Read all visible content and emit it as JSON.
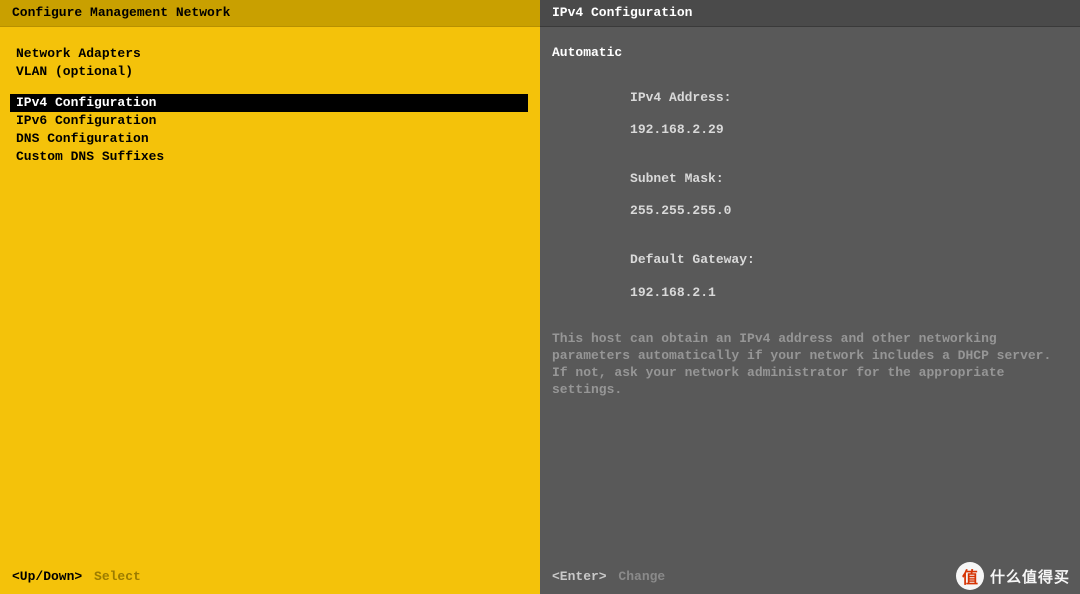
{
  "left": {
    "title": "Configure Management Network",
    "groups": [
      {
        "items": [
          {
            "label": "Network Adapters",
            "selected": false
          },
          {
            "label": "VLAN (optional)",
            "selected": false
          }
        ]
      },
      {
        "items": [
          {
            "label": "IPv4 Configuration",
            "selected": true
          },
          {
            "label": "IPv6 Configuration",
            "selected": false
          },
          {
            "label": "DNS Configuration",
            "selected": false
          },
          {
            "label": "Custom DNS Suffixes",
            "selected": false
          }
        ]
      }
    ],
    "footer_key": "<Up/Down>",
    "footer_action": "Select"
  },
  "right": {
    "title": "IPv4 Configuration",
    "mode": "Automatic",
    "props": [
      {
        "label": "IPv4 Address:",
        "value": "192.168.2.29"
      },
      {
        "label": "Subnet Mask:",
        "value": "255.255.255.0"
      },
      {
        "label": "Default Gateway:",
        "value": "192.168.2.1"
      }
    ],
    "help": "This host can obtain an IPv4 address and other networking parameters automatically if your network includes a DHCP server. If not, ask your network administrator for the appropriate settings.",
    "footer_key": "<Enter>",
    "footer_action": "Change"
  },
  "watermark": {
    "badge": "值",
    "text": "什么值得买"
  }
}
